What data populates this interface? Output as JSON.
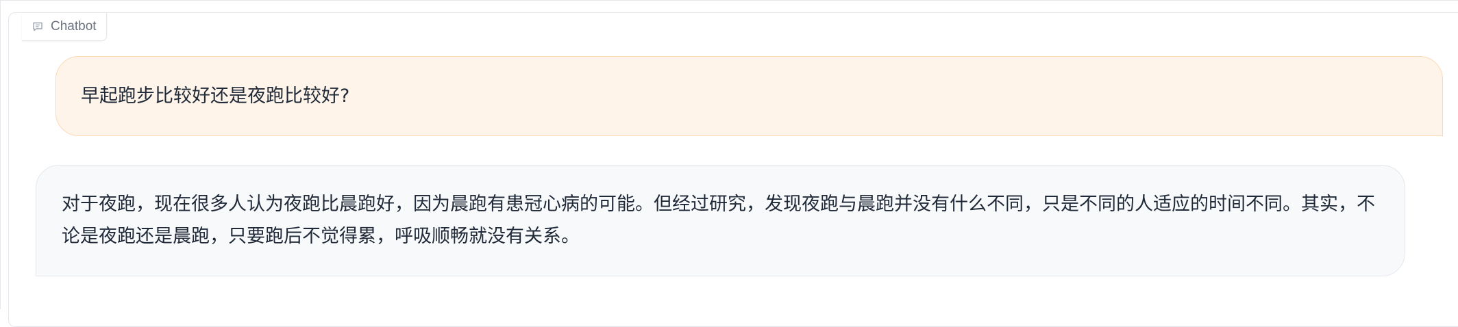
{
  "panel": {
    "label": "Chatbot",
    "label_icon": "chat-bubble-icon"
  },
  "messages": [
    {
      "role": "user",
      "text": "早起跑步比较好还是夜跑比较好?"
    },
    {
      "role": "bot",
      "text": "对于夜跑，现在很多人认为夜跑比晨跑好，因为晨跑有患冠心病的可能。但经过研究，发现夜跑与晨跑并没有什么不同，只是不同的人适应的时间不同。其实，不论是夜跑还是晨跑，只要跑后不觉得累，呼吸顺畅就没有关系。"
    }
  ],
  "colors": {
    "user_bubble_bg": "#fef4e9",
    "user_bubble_border": "#fbd8b4",
    "bot_bubble_bg": "#f8f9fb",
    "border": "#e5e7eb",
    "label_text": "#6b7280"
  }
}
